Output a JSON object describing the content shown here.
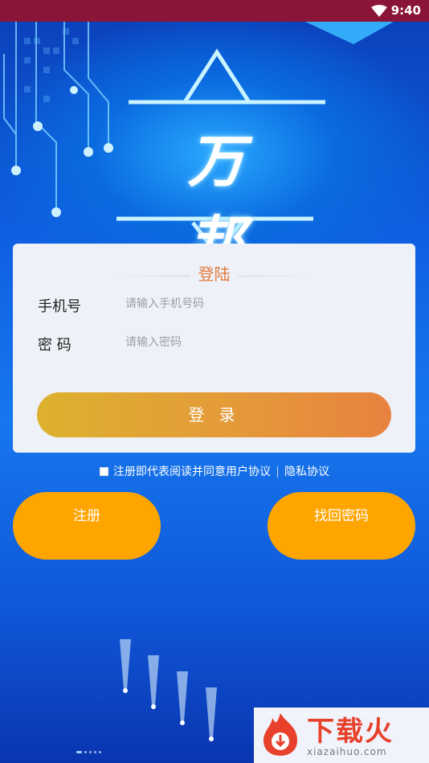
{
  "status_bar": {
    "time": "9:40",
    "wifi_icon": "wifi-icon"
  },
  "logo": {
    "text": "万 邦"
  },
  "login_card": {
    "title": "登陆",
    "phone_label": "手机号",
    "phone_placeholder": "请输入手机号码",
    "password_label": "密 码",
    "password_placeholder": "请输入密码",
    "login_button": "登 录"
  },
  "agreement": {
    "prefix": "注册即代表阅读并同意",
    "user_agreement": "用户协议",
    "privacy": "隐私协议"
  },
  "actions": {
    "register": "注册",
    "recover_password": "找回密码"
  },
  "watermark": {
    "title": "下载火",
    "url": "xiazaihuo.com"
  },
  "colors": {
    "status_bar": "#8a1538",
    "title_accent": "#e27a3c",
    "login_gradient_start": "#ddb12e",
    "login_gradient_end": "#e8823f",
    "pill": "#ffa500",
    "background": "#1677ee"
  }
}
